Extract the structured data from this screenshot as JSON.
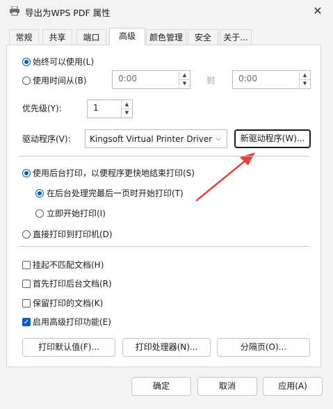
{
  "window": {
    "title": "导出为WPS PDF 属性",
    "close_glyph": "✕"
  },
  "tabs": [
    {
      "label": "常规"
    },
    {
      "label": "共享"
    },
    {
      "label": "端口"
    },
    {
      "label": "高级"
    },
    {
      "label": "颜色管理"
    },
    {
      "label": "安全"
    },
    {
      "label": "关于..."
    }
  ],
  "availability": {
    "always_label": "始终可以使用(L)",
    "from_label": "使用时间从(B)",
    "start_time": "0:00",
    "to_label": "到",
    "end_time": "0:00"
  },
  "priority": {
    "label": "优先级(Y):",
    "value": "1"
  },
  "driver": {
    "label": "驱动程序(V):",
    "selected": "Kingsoft Virtual Printer Driver",
    "new_driver_button": "新驱动程序(W)..."
  },
  "spool": {
    "spool_label": "使用后台打印，以便程序更快地结束打印(S)",
    "after_last_page_label": "在后台处理完最后一页时开始打印(T)",
    "immediately_label": "立即开始打印(I)",
    "direct_label": "直接打印到打印机(D)"
  },
  "options": [
    {
      "label": "挂起不匹配文档(H)",
      "checked": false
    },
    {
      "label": "首先打印后台文档(R)",
      "checked": false
    },
    {
      "label": "保留打印的文档(K)",
      "checked": false
    },
    {
      "label": "启用高级打印功能(E)",
      "checked": true
    }
  ],
  "panel_buttons": {
    "defaults": "打印默认值(F)...",
    "processor": "打印处理器(N)...",
    "separator_page": "分隔页(O)..."
  },
  "dialog_buttons": {
    "ok": "确定",
    "cancel": "取消",
    "apply": "应用(A)"
  },
  "colors": {
    "accent": "#005fb8",
    "annotation_arrow": "#e8413a"
  }
}
